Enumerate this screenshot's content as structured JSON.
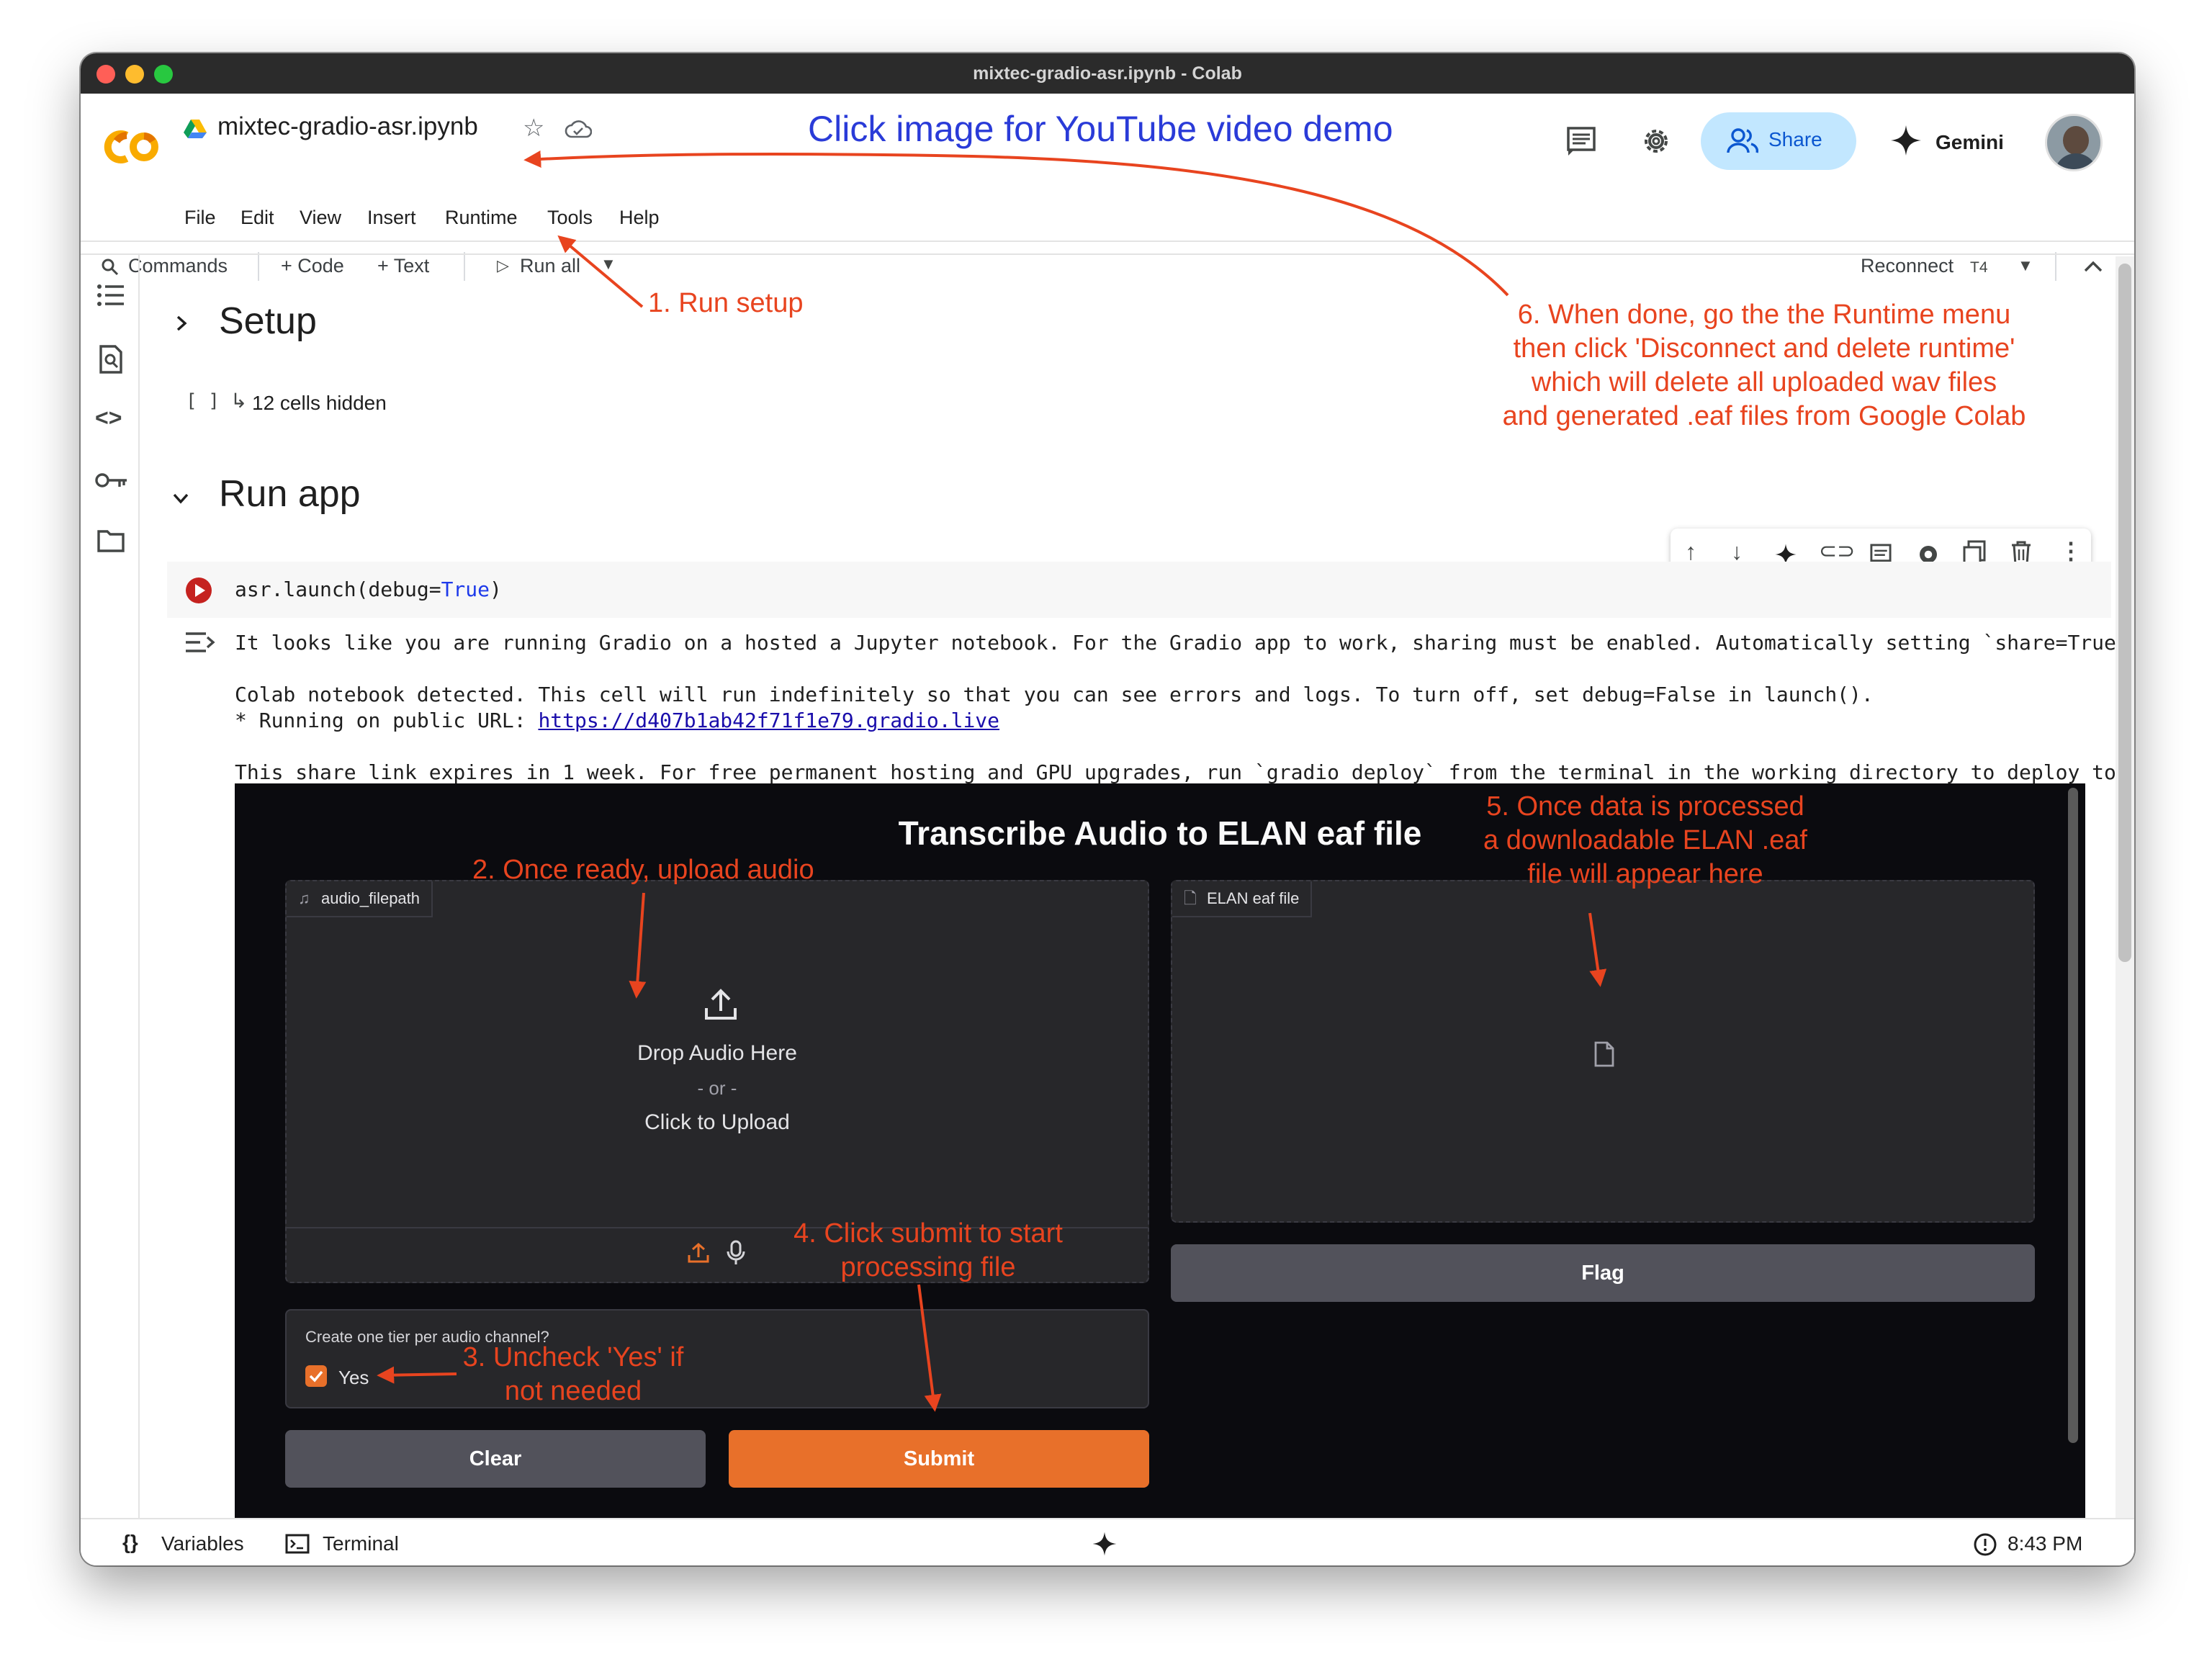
{
  "window": {
    "title": "mixtec-gradio-asr.ipynb - Colab"
  },
  "header": {
    "filename": "mixtec-gradio-asr.ipynb",
    "banner": "Click image for YouTube video demo",
    "menu": [
      "File",
      "Edit",
      "View",
      "Insert",
      "Runtime",
      "Tools",
      "Help"
    ],
    "share_label": "Share",
    "gemini_label": "Gemini"
  },
  "toolbar": {
    "commands": "Commands",
    "code": "+ Code",
    "text": "+ Text",
    "run_all": "Run all",
    "reconnect": "Reconnect",
    "runtime_type": "T4"
  },
  "notebook": {
    "setup_heading": "Setup",
    "hidden_cells": "12 cells hidden",
    "hidden_bracket": "[ ]",
    "run_app_heading": "Run app",
    "code_prefix": "asr.launch(debug=",
    "code_true": "True",
    "code_suffix": ")",
    "output_line1": "It looks like you are running Gradio on a hosted a Jupyter notebook. For the Gradio app to work, sharing must be enabled. Automatically setting `share=True",
    "output_line2": "Colab notebook detected. This cell will run indefinitely so that you can see errors and logs. To turn off, set debug=False in launch().",
    "output_line3_prefix": "* Running on public URL: ",
    "output_url": "https://d407b1ab42f71f1e79.gradio.live",
    "output_line4": "This share link expires in 1 week. For free permanent hosting and GPU upgrades, run `gradio deploy` from the terminal in the working directory to deploy to"
  },
  "gradio": {
    "title": "Transcribe Audio to ELAN eaf file",
    "audio_label": "audio_filepath",
    "drop_text": "Drop Audio Here",
    "or_text": "- or -",
    "click_text": "Click to Upload",
    "output_label": "ELAN eaf file",
    "flag_label": "Flag",
    "checkbox_group_label": "Create one tier per audio channel?",
    "checkbox_label": "Yes",
    "checkbox_checked": true,
    "clear_label": "Clear",
    "submit_label": "Submit"
  },
  "footer": {
    "variables": "Variables",
    "terminal": "Terminal",
    "time": "8:43 PM"
  },
  "annotations": {
    "a1": "1. Run setup",
    "a2": "2. Once ready, upload audio",
    "a3_line1": "3. Uncheck 'Yes' if",
    "a3_line2": "not needed",
    "a4_line1": "4. Click submit to start",
    "a4_line2": "processing file",
    "a5_line1": "5. Once data is processed",
    "a5_line2": "a downloadable ELAN .eaf",
    "a5_line3": "file will appear here",
    "a6_line1": "6. When done, go the the Runtime menu",
    "a6_line2": "then click 'Disconnect and delete runtime'",
    "a6_line3": "which will delete all uploaded wav files",
    "a6_line4": "and generated .eaf files from Google Colab"
  },
  "colors": {
    "annotation": "#e8441f",
    "banner": "#2a3bd8",
    "gradio_accent": "#e8702a",
    "share_bg": "#c2e7ff"
  }
}
